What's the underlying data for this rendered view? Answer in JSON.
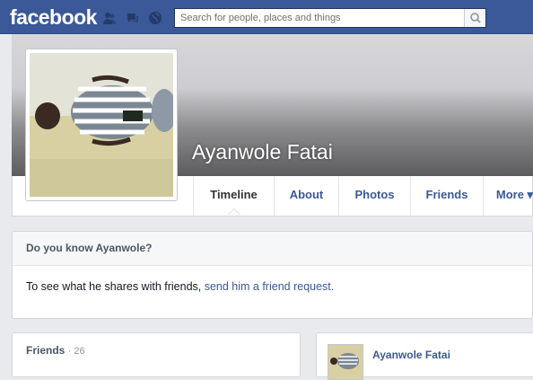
{
  "header": {
    "logo": "facebook",
    "search_placeholder": "Search for people, places and things",
    "jewels": [
      "friend-requests-icon",
      "messages-icon",
      "notifications-icon"
    ]
  },
  "profile": {
    "name": "Ayanwole Fatai"
  },
  "tabs": [
    {
      "label": "Timeline",
      "active": true
    },
    {
      "label": "About",
      "active": false
    },
    {
      "label": "Photos",
      "active": false
    },
    {
      "label": "Friends",
      "active": false
    },
    {
      "label": "More ▾",
      "active": false
    }
  ],
  "know_box": {
    "title": "Do you know Ayanwole?",
    "text": "To see what he shares with friends, ",
    "link": "send him a friend request."
  },
  "friends_box": {
    "title": "Friends",
    "count": "· 26"
  },
  "post": {
    "author": "Ayanwole Fatai"
  },
  "colors": {
    "brand": "#3b5998",
    "page_bg": "#e9eaed"
  }
}
